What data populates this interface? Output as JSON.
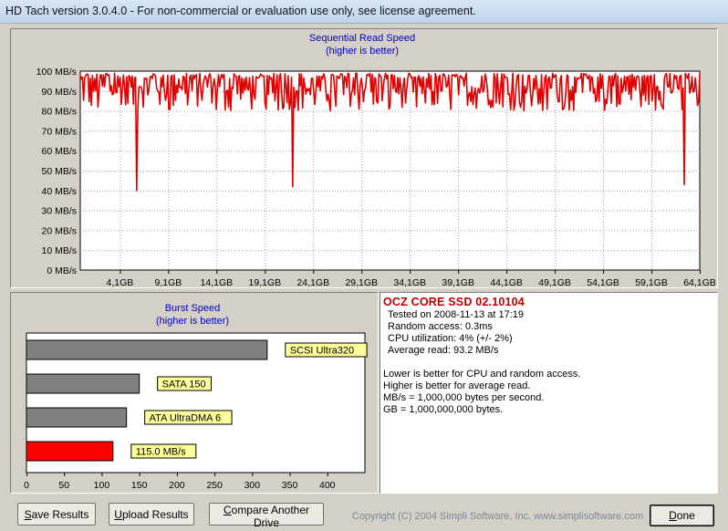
{
  "window": {
    "title": "HD Tach version 3.0.4.0  - For non-commercial or evaluation use only, see license agreement."
  },
  "sequential": {
    "title": "Sequential Read Speed",
    "subtitle": "(higher is better)",
    "y_ticks": [
      "0 MB/s",
      "10 MB/s",
      "20 MB/s",
      "30 MB/s",
      "40 MB/s",
      "50 MB/s",
      "60 MB/s",
      "70 MB/s",
      "80 MB/s",
      "90 MB/s",
      "100 MB/s"
    ],
    "x_ticks": [
      "4,1GB",
      "9,1GB",
      "14,1GB",
      "19,1GB",
      "24,1GB",
      "29,1GB",
      "34,1GB",
      "39,1GB",
      "44,1GB",
      "49,1GB",
      "54,1GB",
      "59,1GB",
      "64,1GB"
    ]
  },
  "burst": {
    "title": "Burst Speed",
    "subtitle": "(higher is better)"
  },
  "chart_data": [
    {
      "type": "line",
      "title": "Sequential Read Speed",
      "subtitle": "(higher is better)",
      "ylabel": "",
      "xlabel": "",
      "ylim": [
        0,
        100
      ],
      "xlim": [
        0,
        64.1
      ],
      "grid": true,
      "series_color": "#e00000",
      "baseline_range": [
        88,
        100
      ],
      "dips": [
        {
          "x": 5.8,
          "y": 40
        },
        {
          "x": 22.0,
          "y": 42
        },
        {
          "x": 62.5,
          "y": 43
        }
      ]
    },
    {
      "type": "bar",
      "orientation": "horizontal",
      "title": "Burst Speed",
      "subtitle": "(higher is better)",
      "xlim": [
        0,
        450
      ],
      "x_ticks": [
        "0",
        "50",
        "100",
        "150",
        "200",
        "250",
        "300",
        "350",
        "400"
      ],
      "bars": [
        {
          "label": "SCSI Ultra320",
          "value": 320,
          "color": "#808080"
        },
        {
          "label": "SATA 150",
          "value": 150,
          "color": "#808080"
        },
        {
          "label": "ATA UltraDMA 6",
          "value": 133,
          "color": "#808080"
        },
        {
          "label": "115.0 MB/s",
          "value": 115,
          "color": "#ff0000"
        }
      ]
    }
  ],
  "info": {
    "drive_name": "OCZ CORE SSD 02.10104",
    "tested_on": "Tested on 2008-11-13 at 17:19",
    "random_access": "Random access: 0.3ms",
    "cpu_util": "CPU utilization: 4% (+/- 2%)",
    "average_read": "Average read: 93.2 MB/s",
    "note1": "Lower is better for CPU and random access.",
    "note2": "Higher is better for average read.",
    "note3": "MB/s = 1,000,000 bytes per second.",
    "note4": "GB = 1,000,000,000 bytes."
  },
  "buttons": {
    "save_pre": "",
    "save_u": "S",
    "save_post": "ave Results",
    "upload_pre": "",
    "upload_u": "U",
    "upload_post": "pload Results",
    "compare_pre": "",
    "compare_u": "C",
    "compare_post": "ompare Another Drive",
    "done_pre": "",
    "done_u": "D",
    "done_post": "one"
  },
  "copyright": "Copyright (C) 2004 Simpli Software, Inc. www.simplisoftware.com"
}
